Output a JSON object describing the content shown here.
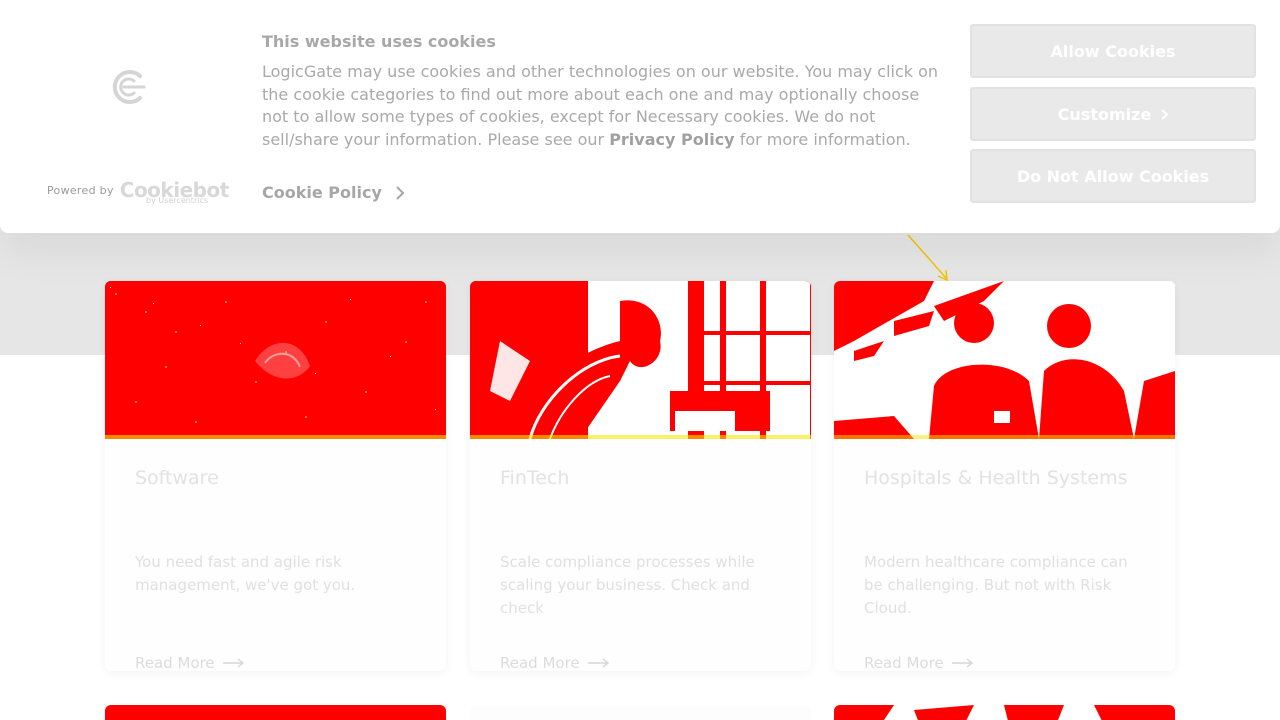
{
  "cookie_banner": {
    "title": "This website uses cookies",
    "text_before_link": "LogicGate may use cookies and other technologies on our website. You may click on the cookie categories to find out more about each one and may optionally choose not to allow some types of cookies, except for Necessary cookies.  We do not sell/share your information. Please see our ",
    "privacy_link": "Privacy Policy",
    "text_after_link": " for more information.",
    "cookie_policy_label": "Cookie Policy",
    "powered_by": "Powered by",
    "cookiebot_brand": "Cookiebot",
    "usercentrics": "by Usercentrics",
    "buttons": {
      "allow": "Allow Cookies",
      "customize": "Customize",
      "deny": "Do Not Allow Cookies"
    }
  },
  "cards": [
    {
      "title": "Software",
      "description": "You need fast and agile risk management, we've got you.",
      "link": "Read More"
    },
    {
      "title": "FinTech",
      "description": "Scale compliance processes while scaling your business. Check and check",
      "link": "Read More"
    },
    {
      "title": "Hospitals & Health Systems",
      "description": "Modern healthcare compliance can be challenging. But not with Risk Cloud.",
      "link": "Read More"
    }
  ],
  "colors": {
    "image_tint": "#ff0000",
    "banner_bg": "#ffffff",
    "band_bg": "#e6e6e6"
  },
  "icons": {
    "logo": "logicgate-logo-icon",
    "chevron": "chevron-right-icon",
    "arrow": "arrow-right-icon"
  }
}
